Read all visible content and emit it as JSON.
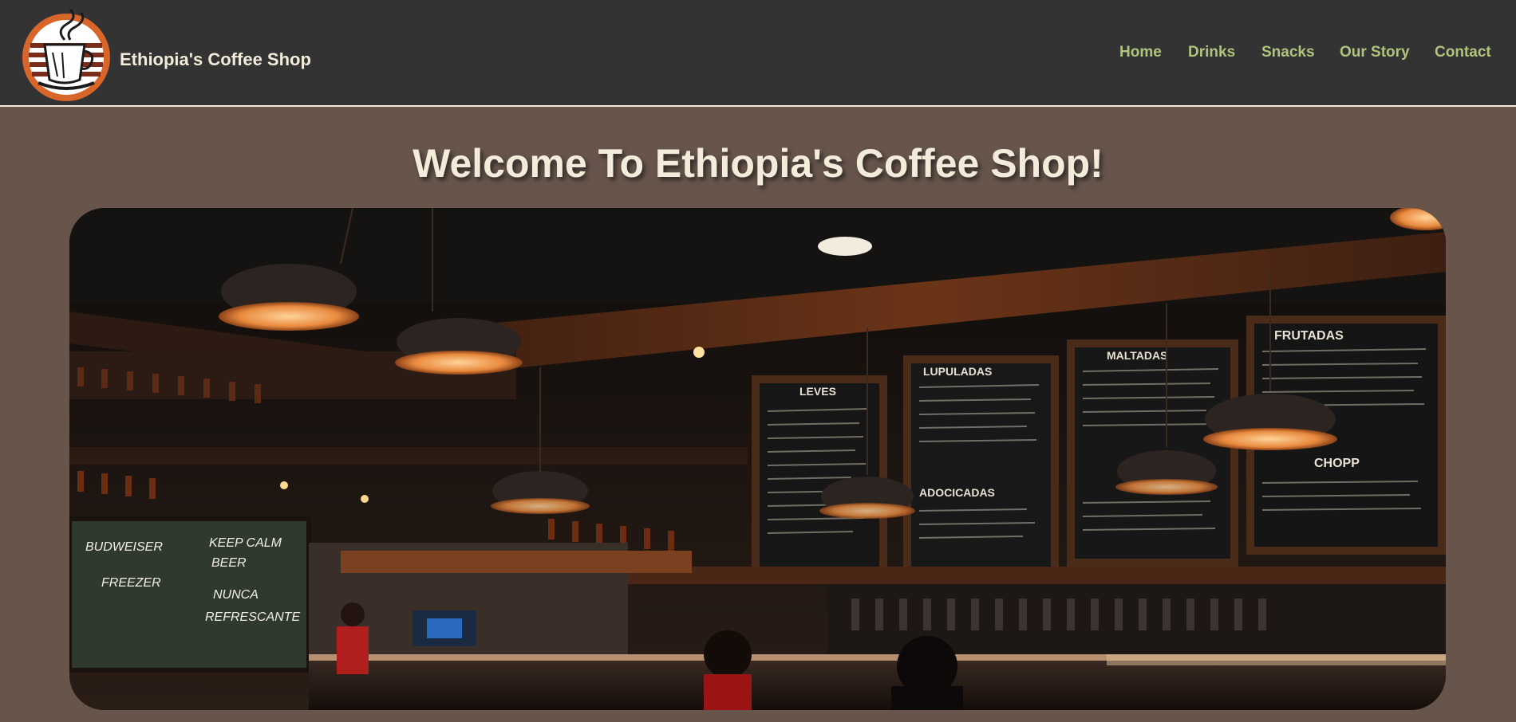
{
  "site": {
    "name": "Ethiopia's Coffee Shop",
    "logo_icon": "coffee-cup-logo-icon"
  },
  "nav": {
    "items": [
      {
        "label": "Home"
      },
      {
        "label": "Drinks"
      },
      {
        "label": "Snacks"
      },
      {
        "label": "Our Story"
      },
      {
        "label": "Contact"
      }
    ]
  },
  "main": {
    "heading": "Welcome To Ethiopia's Coffee Shop!"
  },
  "hero_image": {
    "description_icon": "cafe-interior-photo",
    "menu_boards": [
      {
        "title": "LEVES"
      },
      {
        "title": "LUPULADAS"
      },
      {
        "title": "MALTADAS"
      },
      {
        "title": "FRUTADAS"
      },
      {
        "title": "ADOCICADAS"
      },
      {
        "title": "CHOPP"
      }
    ],
    "chalkboard_lines": [
      "BUDWEISER",
      "FREEZER",
      "KEEP CALM",
      "BEER",
      "NUNCA",
      "REFRESCANTE"
    ]
  },
  "colors": {
    "header_bg": "#333333",
    "page_bg": "#67554c",
    "cream": "#f3ecda",
    "nav_green": "#b1c47e",
    "logo_orange": "#d8652a"
  }
}
